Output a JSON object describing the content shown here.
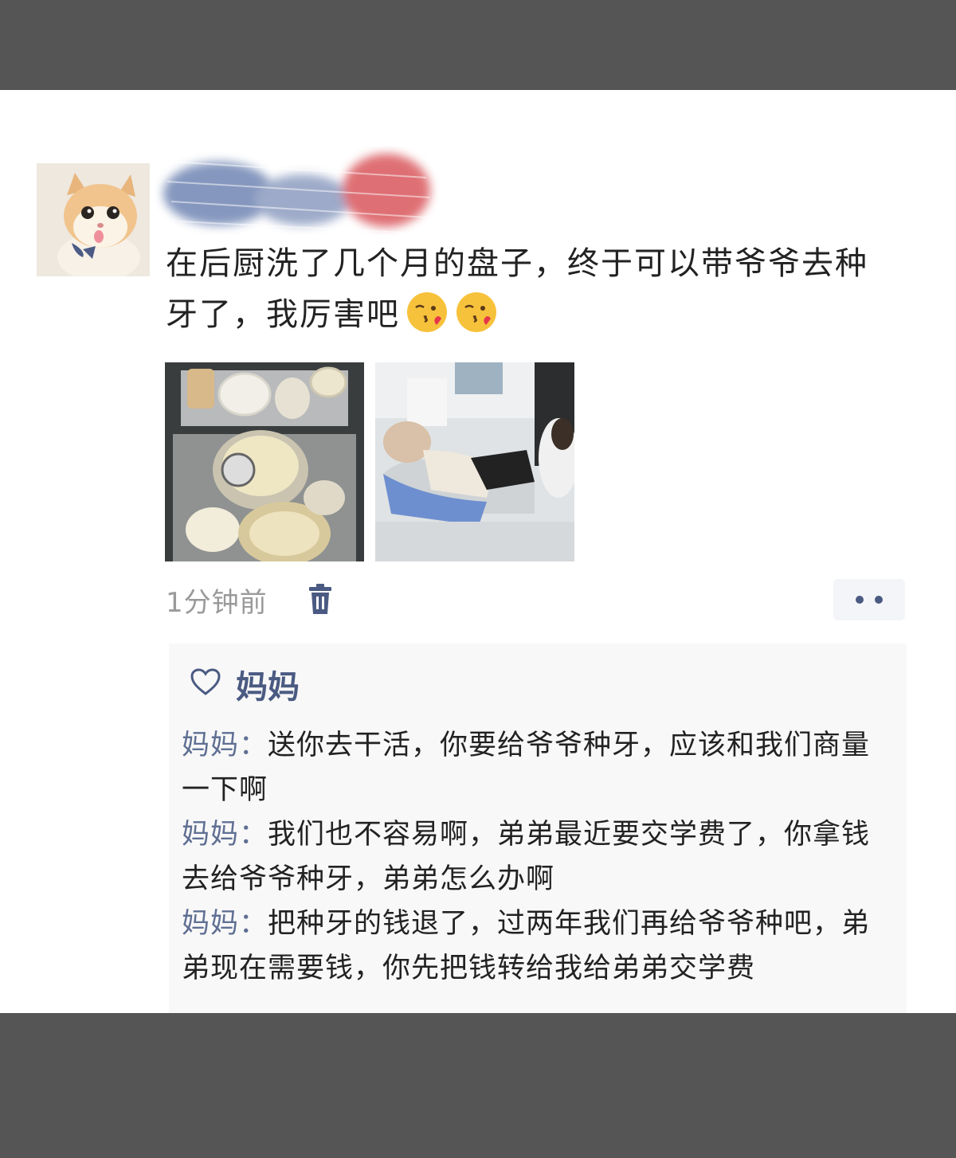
{
  "post": {
    "text": "在后厨洗了几个月的盘子，终于可以带爷爷去种牙了，我厉害吧",
    "emojis": [
      "kissing-heart-emoji",
      "kissing-heart-emoji"
    ],
    "images": [
      "dish-sink-photo",
      "dental-chair-photo"
    ],
    "timestamp": "1分钟前"
  },
  "likes": {
    "names": "妈妈"
  },
  "comments": [
    {
      "author": "妈妈",
      "separator": "：",
      "text": "送你去干活，你要给爷爷种牙，应该和我们商量一下啊"
    },
    {
      "author": "妈妈",
      "separator": "：",
      "text": "我们也不容易啊，弟弟最近要交学费了，你拿钱去给爷爷种牙，弟弟怎么办啊"
    },
    {
      "author": "妈妈",
      "separator": "：",
      "text": "把种牙的钱退了，过两年我们再给爷爷种吧，弟弟现在需要钱，你先把钱转给我给弟弟交学费"
    }
  ],
  "icons": {
    "delete": "trash-icon",
    "more": "more-dots-icon",
    "like": "heart-outline-icon"
  },
  "colors": {
    "link_blue": "#4a5a82",
    "author_blue": "#5f6f93",
    "timestamp_gray": "#9a9a9a",
    "band_gray": "#555555"
  }
}
